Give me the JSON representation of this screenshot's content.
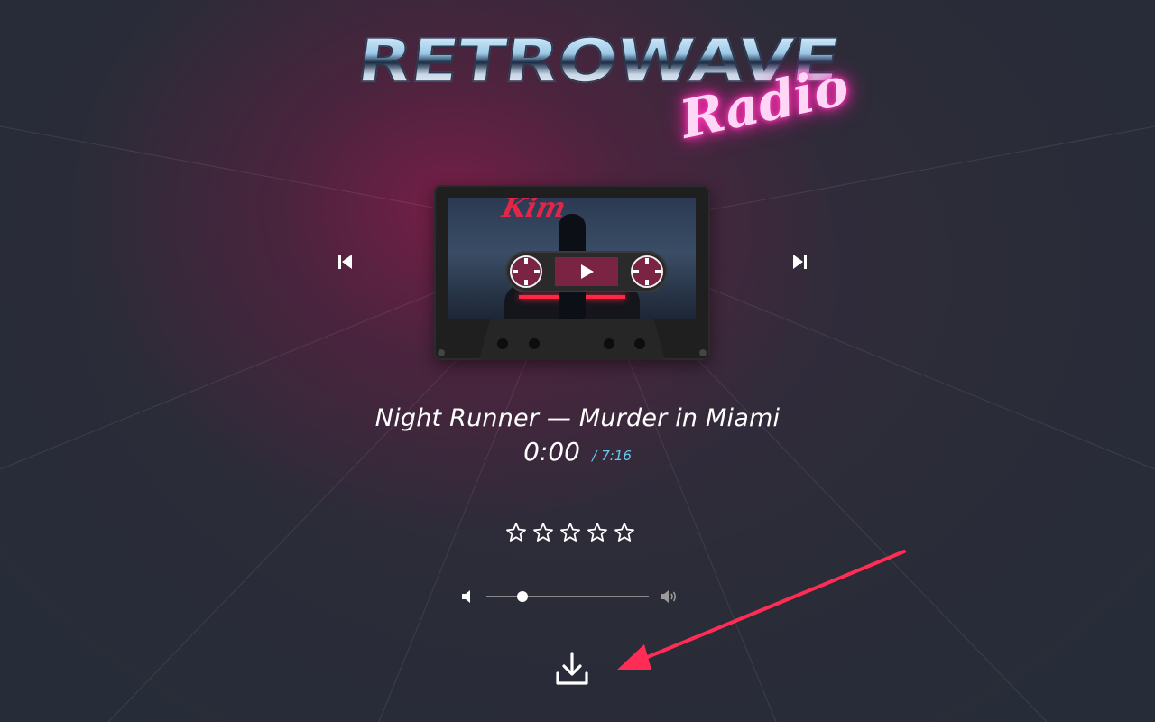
{
  "brand": {
    "logo_word": "RETROWAVE",
    "logo_script": "Radio"
  },
  "cassette": {
    "art_text": "Kim",
    "play_icon": "play-icon",
    "reel_icon": "reel-icon"
  },
  "controls": {
    "prev_icon": "skip-previous-icon",
    "next_icon": "skip-next-icon"
  },
  "track": {
    "title": "Night Runner — Murder in Miami",
    "current_time": "0:00",
    "separator": "/",
    "total_time": "7:16"
  },
  "rating": {
    "stars_total": 5,
    "stars_filled": 0,
    "icon": "star-outline-icon"
  },
  "volume": {
    "level": 0.22,
    "down_icon": "volume-low-icon",
    "up_icon": "volume-high-icon"
  },
  "download": {
    "icon": "download-icon"
  },
  "colors": {
    "accent_pink": "#ff2d55",
    "reel_maroon": "#7a2342",
    "time_total_blue": "#68c7ee",
    "neon_pink": "#ff2db0",
    "background": "#262d38"
  }
}
